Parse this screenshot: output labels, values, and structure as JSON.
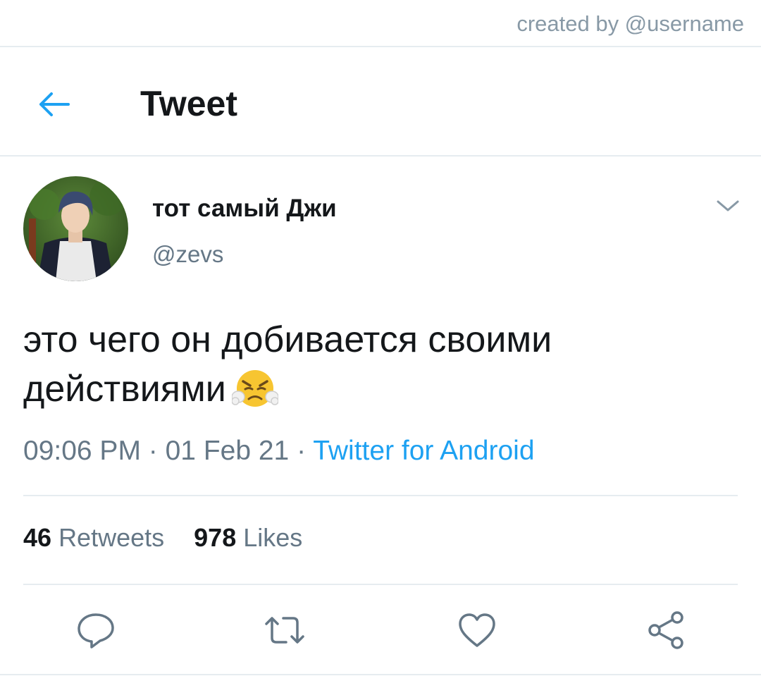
{
  "credit": "created by @username",
  "header": {
    "title": "Tweet"
  },
  "tweet": {
    "author": {
      "display_name": "тот самый Джи",
      "handle": "@zevs"
    },
    "text_line1": "это чего он добивается своими",
    "text_line2": "действиями",
    "emoji": "face-with-steam-from-nose",
    "time": "09:06 PM",
    "date": "01 Feb 21",
    "separator": " · ",
    "source": "Twitter for Android"
  },
  "stats": {
    "retweets_count": "46",
    "retweets_label": "Retweets",
    "likes_count": "978",
    "likes_label": "Likes"
  },
  "icons": [
    "back-arrow-icon",
    "chevron-down-icon",
    "reply-icon",
    "retweet-icon",
    "like-icon",
    "share-icon"
  ],
  "colors": {
    "accent": "#1da1f2",
    "secondary_text": "#657786",
    "icon": "#657786",
    "divider": "#e6ecf0"
  }
}
